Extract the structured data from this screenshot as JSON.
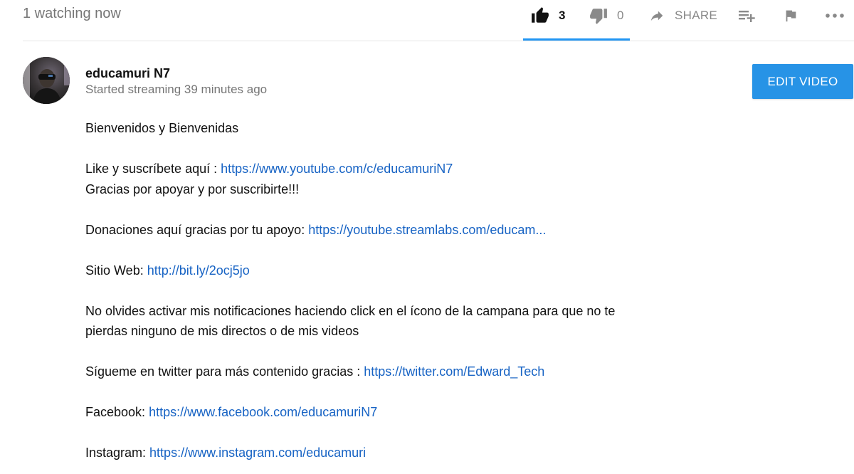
{
  "topbar": {
    "view_count": "1 watching now",
    "like_count": "3",
    "dislike_count": "0",
    "share_label": "SHARE",
    "accent_color": "#2196f3"
  },
  "owner": {
    "channel_name": "educamuri N7",
    "stream_time": "Started streaming 39 minutes ago",
    "edit_button_label": "EDIT VIDEO",
    "button_color": "#2793e6"
  },
  "description": {
    "greeting": "Bienvenidos y Bienvenidas",
    "subscribe_text": "Like y suscríbete aquí : ",
    "subscribe_link": "https://www.youtube.com/c/educamuriN7",
    "thanks": "Gracias por apoyar y por suscribirte!!!",
    "donation_text": "Donaciones aquí gracias por tu apoyo: ",
    "donation_link": "https://youtube.streamlabs.com/educam...",
    "website_text": "Sitio Web: ",
    "website_link": "http://bit.ly/2ocj5jo",
    "notification_line1": "No olvides activar mis notificaciones haciendo click en el ícono de la campana para que no te",
    "notification_line2": "pierdas ninguno de mis directos o de mis videos",
    "twitter_text": "Sígueme en twitter para más contenido gracias : ",
    "twitter_link": "https://twitter.com/Edward_Tech",
    "facebook_text": "Facebook: ",
    "facebook_link": "https://www.facebook.com/educamuriN7",
    "instagram_text": "Instagram: ",
    "instagram_link": "https://www.instagram.com/educamuri",
    "link_color": "#1763c4"
  },
  "icons": {
    "like": "thumbs-up-icon",
    "dislike": "thumbs-down-icon",
    "share": "share-arrow-icon",
    "add_to": "playlist-add-icon",
    "report": "flag-icon",
    "more": "more-horizontal-icon"
  }
}
